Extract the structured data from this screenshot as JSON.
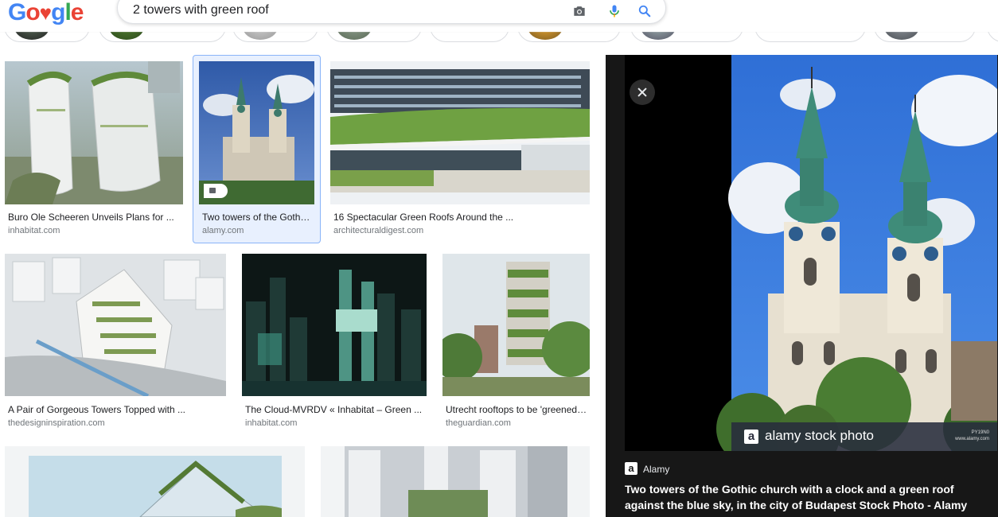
{
  "header": {
    "logo_letters": [
      {
        "ch": "G",
        "color": "#4285f4"
      },
      {
        "ch": "o",
        "color": "#ea4335"
      },
      {
        "ch": "o",
        "color": "#ea4335"
      },
      {
        "ch": "g",
        "color": "#4285f4"
      },
      {
        "ch": "l",
        "color": "#34a853"
      },
      {
        "ch": "e",
        "color": "#ea4335"
      }
    ],
    "search_value": "2 towers with green roof",
    "icons": [
      "camera-icon",
      "microphone-icon",
      "search-icon"
    ]
  },
  "results": [
    {
      "title": "Buro Ole Scheeren Unveils Plans for ...",
      "source": "inhabitat.com"
    },
    {
      "title": "Two towers of the Gothic church with a clock",
      "source": "alamy.com",
      "selected": true
    },
    {
      "title": "16 Spectacular Green Roofs Around the ...",
      "source": "architecturaldigest.com"
    },
    {
      "title": "A Pair of Gorgeous Towers Topped with ...",
      "source": "thedesigninspiration.com"
    },
    {
      "title": "The Cloud-MVRDV « Inhabitat – Green ...",
      "source": "inhabitat.com"
    },
    {
      "title": "Utrecht rooftops to be 'greened' with ...",
      "source": "theguardian.com"
    }
  ],
  "preview": {
    "source_name": "Alamy",
    "source_letter": "a",
    "title": "Two towers of the Gothic church with a clock and a green roof against the blue sky, in the city of Budapest Stock Photo - Alamy",
    "watermark_letter": "a",
    "watermark": "alamy stock photo",
    "watermark_id": "PY19N0",
    "watermark_url": "www.alamy.com"
  },
  "colors": {
    "accent_blue": "#1a73e8",
    "selected_border": "#8ab4f8",
    "panel_bg": "#171717"
  }
}
